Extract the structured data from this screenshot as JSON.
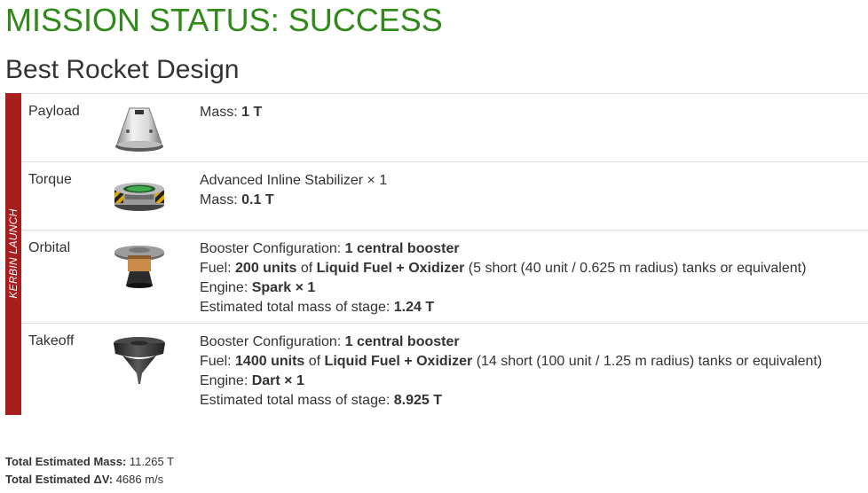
{
  "header": {
    "status": "MISSION STATUS: SUCCESS",
    "status_color": "#2f8a1a",
    "design_title": "Best Rocket Design"
  },
  "launch_bar": {
    "label": "KERBIN LAUNCH",
    "color": "#a81d1d"
  },
  "stages": [
    {
      "name": "Payload",
      "icon": "capsule-icon",
      "mass_label": "Mass:",
      "mass_value": "1 T"
    },
    {
      "name": "Torque",
      "icon": "stabilizer-icon",
      "part": "Advanced Inline Stabilizer × 1",
      "mass_label": "Mass:",
      "mass_value": "0.1 T"
    },
    {
      "name": "Orbital",
      "icon": "spark-engine-icon",
      "booster_label": "Booster Configuration:",
      "booster_value": "1 central booster",
      "fuel_label": "Fuel:",
      "fuel_units": "200 units",
      "fuel_of": "of",
      "fuel_type": "Liquid Fuel + Oxidizer",
      "fuel_note": "(5 short (40 unit / 0.625 m radius) tanks or equivalent)",
      "engine_label": "Engine:",
      "engine_value": "Spark × 1",
      "stage_mass_label": "Estimated total mass of stage:",
      "stage_mass_value": "1.24 T"
    },
    {
      "name": "Takeoff",
      "icon": "dart-engine-icon",
      "booster_label": "Booster Configuration:",
      "booster_value": "1 central booster",
      "fuel_label": "Fuel:",
      "fuel_units": "1400 units",
      "fuel_of": "of",
      "fuel_type": "Liquid Fuel + Oxidizer",
      "fuel_note": "(14 short (100 unit / 1.25 m radius) tanks or equivalent)",
      "engine_label": "Engine:",
      "engine_value": "Dart × 1",
      "stage_mass_label": "Estimated total mass of stage:",
      "stage_mass_value": "8.925 T"
    }
  ],
  "totals": {
    "mass_label": "Total Estimated Mass:",
    "mass_value": "11.265 T",
    "dv_label": "Total Estimated ΔV:",
    "dv_value": "4686 m/s"
  }
}
